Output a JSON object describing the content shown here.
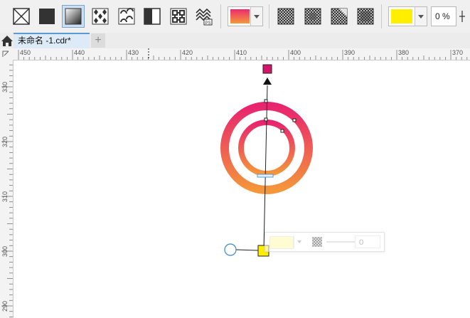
{
  "toolbar": {
    "tools": [
      {
        "name": "no-fill-icon"
      },
      {
        "name": "uniform-fill-icon"
      },
      {
        "name": "fountain-fill-icon",
        "selected": true
      },
      {
        "name": "vector-pattern-icon"
      },
      {
        "name": "bitmap-pattern-icon"
      },
      {
        "name": "two-color-pattern-icon"
      },
      {
        "name": "texture-fill-icon"
      },
      {
        "name": "postscript-fill-icon"
      }
    ],
    "gradient_colors": [
      "#ec2a6c",
      "#f59a3a"
    ],
    "transparency_tools": [
      "checker-transparency-icon-1",
      "checker-transparency-icon-2",
      "checker-transparency-icon-3",
      "checker-transparency-icon-4"
    ],
    "node_color": "#ffee00",
    "node_transparency": "0 %"
  },
  "tabs": {
    "active_label": "未命名 -1.cdr*",
    "add_label": "+"
  },
  "ruler": {
    "h_labels": [
      "450",
      "440",
      "430",
      "420",
      "410",
      "400",
      "390",
      "380",
      "370"
    ],
    "v_labels": [
      "330",
      "320",
      "310",
      "300",
      "290"
    ]
  },
  "canvas": {
    "ring_gradient": [
      "#e8246e",
      "#f4963a"
    ],
    "start_node_color": "#d6156a",
    "end_node_color": "#ffee00"
  },
  "popup": {
    "color": "#fefcd0",
    "transparency_value": "0"
  }
}
